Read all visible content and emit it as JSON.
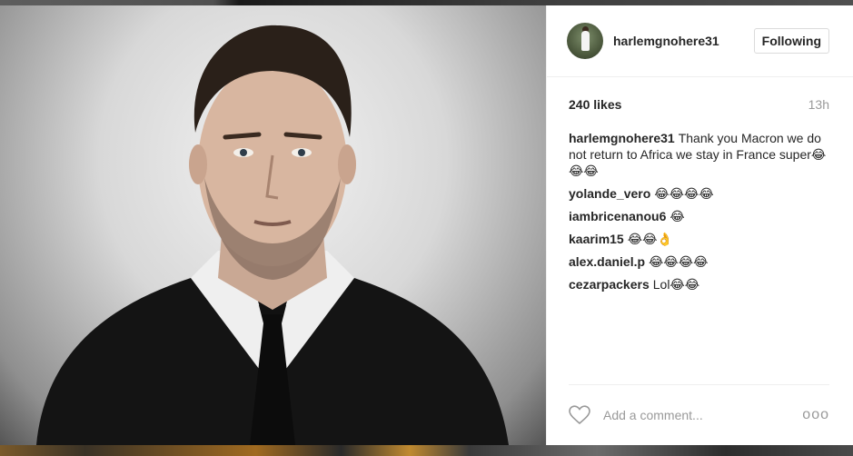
{
  "post": {
    "username": "harlemgnohere31",
    "follow_label": "Following",
    "likes": "240 likes",
    "time": "13h"
  },
  "comments": [
    {
      "user": "harlemgnohere31",
      "text": "Thank you Macron we do not return to Africa we stay in France super😂😂😂"
    },
    {
      "user": "yolande_vero",
      "text": "😂😂😂😂"
    },
    {
      "user": "iambricenanou6",
      "text": "😂"
    },
    {
      "user": "kaarim15",
      "text": "😂😂👌"
    },
    {
      "user": "alex.daniel.p",
      "text": "😂😂😂😂"
    },
    {
      "user": "cezarpackers",
      "text": "Lol😂😂"
    }
  ],
  "composer": {
    "placeholder": "Add a comment...",
    "more_label": "ooo"
  },
  "icons": {
    "like": "heart-icon",
    "more": "more-options-icon"
  }
}
